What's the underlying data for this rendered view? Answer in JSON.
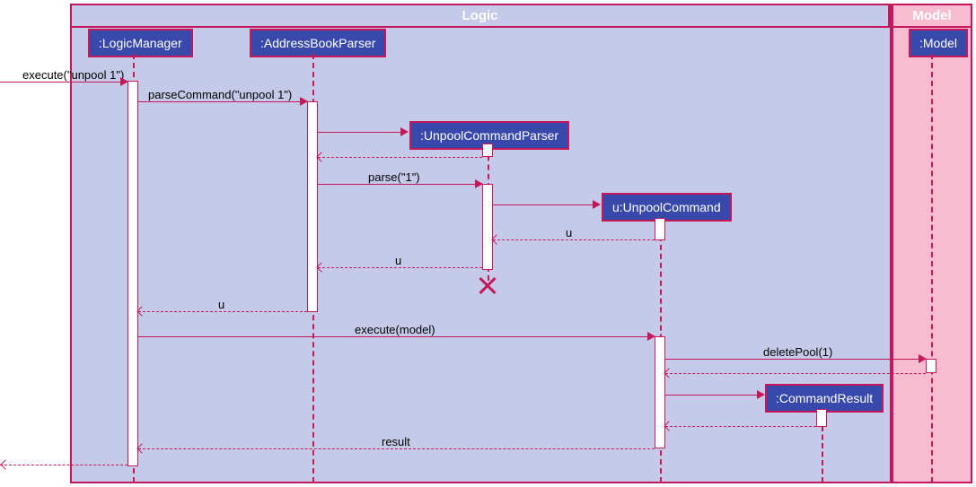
{
  "frames": {
    "logic": "Logic",
    "model": "Model"
  },
  "participants": {
    "logicManager": ":LogicManager",
    "addressBookParser": ":AddressBookParser",
    "unpoolCommandParser": ":UnpoolCommandParser",
    "unpoolCommand": "u:UnpoolCommand",
    "commandResult": ":CommandResult",
    "model": ":Model"
  },
  "messages": {
    "execute1": "execute(\"unpool 1\")",
    "parseCommand": "parseCommand(\"unpool 1\")",
    "parse": "parse(\"1\")",
    "u1": "u",
    "u2": "u",
    "u3": "u",
    "executeModel": "execute(model)",
    "deletePool": "deletePool(1)",
    "result": "result"
  },
  "chart_data": {
    "type": "sequence_diagram",
    "frames": [
      {
        "name": "Logic",
        "participants": [
          "LogicManager",
          "AddressBookParser",
          "UnpoolCommandParser",
          "UnpoolCommand",
          "CommandResult"
        ]
      },
      {
        "name": "Model",
        "participants": [
          "Model"
        ]
      }
    ],
    "participants": [
      {
        "id": "LogicManager",
        "label": ":LogicManager"
      },
      {
        "id": "AddressBookParser",
        "label": ":AddressBookParser"
      },
      {
        "id": "UnpoolCommandParser",
        "label": ":UnpoolCommandParser",
        "created_by_message": 2
      },
      {
        "id": "UnpoolCommand",
        "label": "u:UnpoolCommand",
        "created_by_message": 4
      },
      {
        "id": "CommandResult",
        "label": ":CommandResult",
        "created_by_message": 11
      },
      {
        "id": "Model",
        "label": ":Model"
      }
    ],
    "messages": [
      {
        "seq": 1,
        "from": "external",
        "to": "LogicManager",
        "label": "execute(\"unpool 1\")",
        "type": "sync"
      },
      {
        "seq": 2,
        "from": "LogicManager",
        "to": "AddressBookParser",
        "label": "parseCommand(\"unpool 1\")",
        "type": "sync"
      },
      {
        "seq": 3,
        "from": "AddressBookParser",
        "to": "UnpoolCommandParser",
        "label": "",
        "type": "create"
      },
      {
        "seq": 4,
        "from": "UnpoolCommandParser",
        "to": "AddressBookParser",
        "label": "",
        "type": "return"
      },
      {
        "seq": 5,
        "from": "AddressBookParser",
        "to": "UnpoolCommandParser",
        "label": "parse(\"1\")",
        "type": "sync"
      },
      {
        "seq": 6,
        "from": "UnpoolCommandParser",
        "to": "UnpoolCommand",
        "label": "",
        "type": "create"
      },
      {
        "seq": 7,
        "from": "UnpoolCommand",
        "to": "UnpoolCommandParser",
        "label": "u",
        "type": "return"
      },
      {
        "seq": 8,
        "from": "UnpoolCommandParser",
        "to": "AddressBookParser",
        "label": "u",
        "type": "return",
        "destroys": "UnpoolCommandParser"
      },
      {
        "seq": 9,
        "from": "AddressBookParser",
        "to": "LogicManager",
        "label": "u",
        "type": "return"
      },
      {
        "seq": 10,
        "from": "LogicManager",
        "to": "UnpoolCommand",
        "label": "execute(model)",
        "type": "sync"
      },
      {
        "seq": 11,
        "from": "UnpoolCommand",
        "to": "Model",
        "label": "deletePool(1)",
        "type": "sync"
      },
      {
        "seq": 12,
        "from": "Model",
        "to": "UnpoolCommand",
        "label": "",
        "type": "return"
      },
      {
        "seq": 13,
        "from": "UnpoolCommand",
        "to": "CommandResult",
        "label": "",
        "type": "create"
      },
      {
        "seq": 14,
        "from": "CommandResult",
        "to": "UnpoolCommand",
        "label": "",
        "type": "return"
      },
      {
        "seq": 15,
        "from": "UnpoolCommand",
        "to": "LogicManager",
        "label": "result",
        "type": "return"
      },
      {
        "seq": 16,
        "from": "LogicManager",
        "to": "external",
        "label": "",
        "type": "return"
      }
    ]
  }
}
